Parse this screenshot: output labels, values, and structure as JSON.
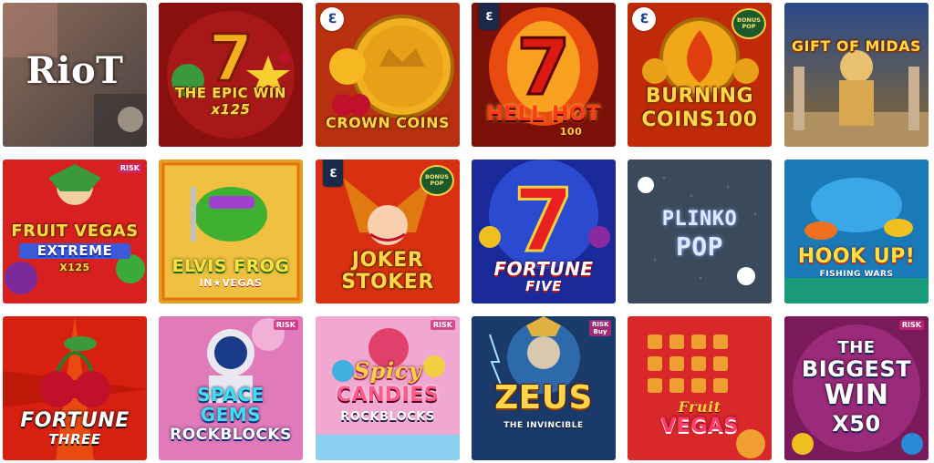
{
  "games": [
    {
      "id": "riot",
      "title": "RioT",
      "row": 0,
      "col": 0
    },
    {
      "id": "epic-win",
      "title": "THE EPIC WIN",
      "sub": "x125",
      "row": 0,
      "col": 1
    },
    {
      "id": "crown-coins",
      "title": "CROWN COINS",
      "row": 0,
      "col": 2
    },
    {
      "id": "hell-hot",
      "title": "HELL HOT",
      "sub": "100",
      "row": 0,
      "col": 3
    },
    {
      "id": "burning-coins",
      "title": "BURNING",
      "sub": "COINS100",
      "badge": "BONUS POP",
      "row": 0,
      "col": 4
    },
    {
      "id": "gift-of-midas",
      "title": "GIFT OF MIDAS",
      "row": 0,
      "col": 5
    },
    {
      "id": "fruit-vegas-extreme",
      "title": "FRUIT VEGAS",
      "sub": "EXTREME",
      "sub2": "X125",
      "badge": "RISK",
      "row": 1,
      "col": 0
    },
    {
      "id": "elvis-frog",
      "title": "ELVIS FROG",
      "sub": "IN★VEGAS",
      "row": 1,
      "col": 1
    },
    {
      "id": "joker-stoker",
      "title": "JOKER",
      "sub": "STOKER",
      "badge": "BONUS POP",
      "row": 1,
      "col": 2
    },
    {
      "id": "fortune-five",
      "title": "FORTUNE",
      "sub": "FIVE",
      "row": 1,
      "col": 3
    },
    {
      "id": "plinko-pop",
      "title": "PLINKO",
      "sub": "POP",
      "row": 1,
      "col": 4
    },
    {
      "id": "hook-up",
      "title": "HOOK UP!",
      "sub": "FISHING WARS",
      "row": 1,
      "col": 5
    },
    {
      "id": "fortune-three",
      "title": "FORTUNE",
      "sub": "THREE",
      "row": 2,
      "col": 0
    },
    {
      "id": "space-gems",
      "title": "SPACE",
      "sub": "GEMS",
      "sub2": "ROCKBLOCKS",
      "badge": "RISK",
      "row": 2,
      "col": 1
    },
    {
      "id": "spicy-candies",
      "title": "Spicy",
      "sub": "CANDIES",
      "sub2": "ROCKBLOCKS",
      "badge": "RISK",
      "row": 2,
      "col": 2
    },
    {
      "id": "zeus",
      "title": "ZEUS",
      "sub": "THE INVINCIBLE",
      "badge": "RISK Buy",
      "row": 2,
      "col": 3
    },
    {
      "id": "fruit-vegas",
      "title": "Fruit",
      "sub": "VEGAS",
      "row": 2,
      "col": 4
    },
    {
      "id": "biggest-win",
      "title": "THE",
      "sub": "BIGGEST",
      "sub2": "WIN",
      "sub3": "X50",
      "badge": "RISK",
      "row": 2,
      "col": 5
    }
  ],
  "labels": {
    "bonus_pop": "BONUS POP",
    "risk": "RISK",
    "risk_buy": "RISK Buy"
  }
}
